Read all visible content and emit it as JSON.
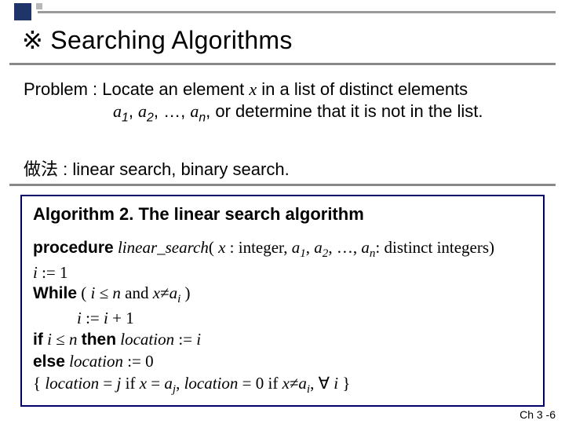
{
  "header": {
    "title": "※ Searching Algorithms"
  },
  "problem": {
    "line1_prefix": "Problem : Locate an element ",
    "x": "x",
    "line1_suffix": " in a list of distinct elements",
    "line2_seq": "a",
    "line2_seq_full": ", or determine that it is not in the list."
  },
  "methods": {
    "label": "做法 : linear search, binary search."
  },
  "algorithm": {
    "title": "Algorithm 2. The linear search algorithm",
    "proc_kw": "procedure",
    "proc_name": "linear_search",
    "proc_sig_mid": " : integer, ",
    "proc_sig_end": ": distinct integers)",
    "init": " := 1",
    "while_kw": "While",
    "while_cond_open": "  ( ",
    "while_cond_le": " ≤ ",
    "while_cond_and": " and ",
    "while_cond_neq": "≠",
    "while_cond_close": " )",
    "step": " := ",
    "step_plus": " + 1",
    "if_kw": "if",
    "then_kw": "then",
    "else_kw": "else",
    "loc": "location",
    "loc_zero": " := 0",
    "comment_open": "{ ",
    "comment_eqj": " = ",
    "comment_if": "  if  ",
    "comment_semicolon": ", ",
    "comment_forall": "∀",
    "comment_close": " }"
  },
  "footer": {
    "page": "Ch 3 -6"
  }
}
